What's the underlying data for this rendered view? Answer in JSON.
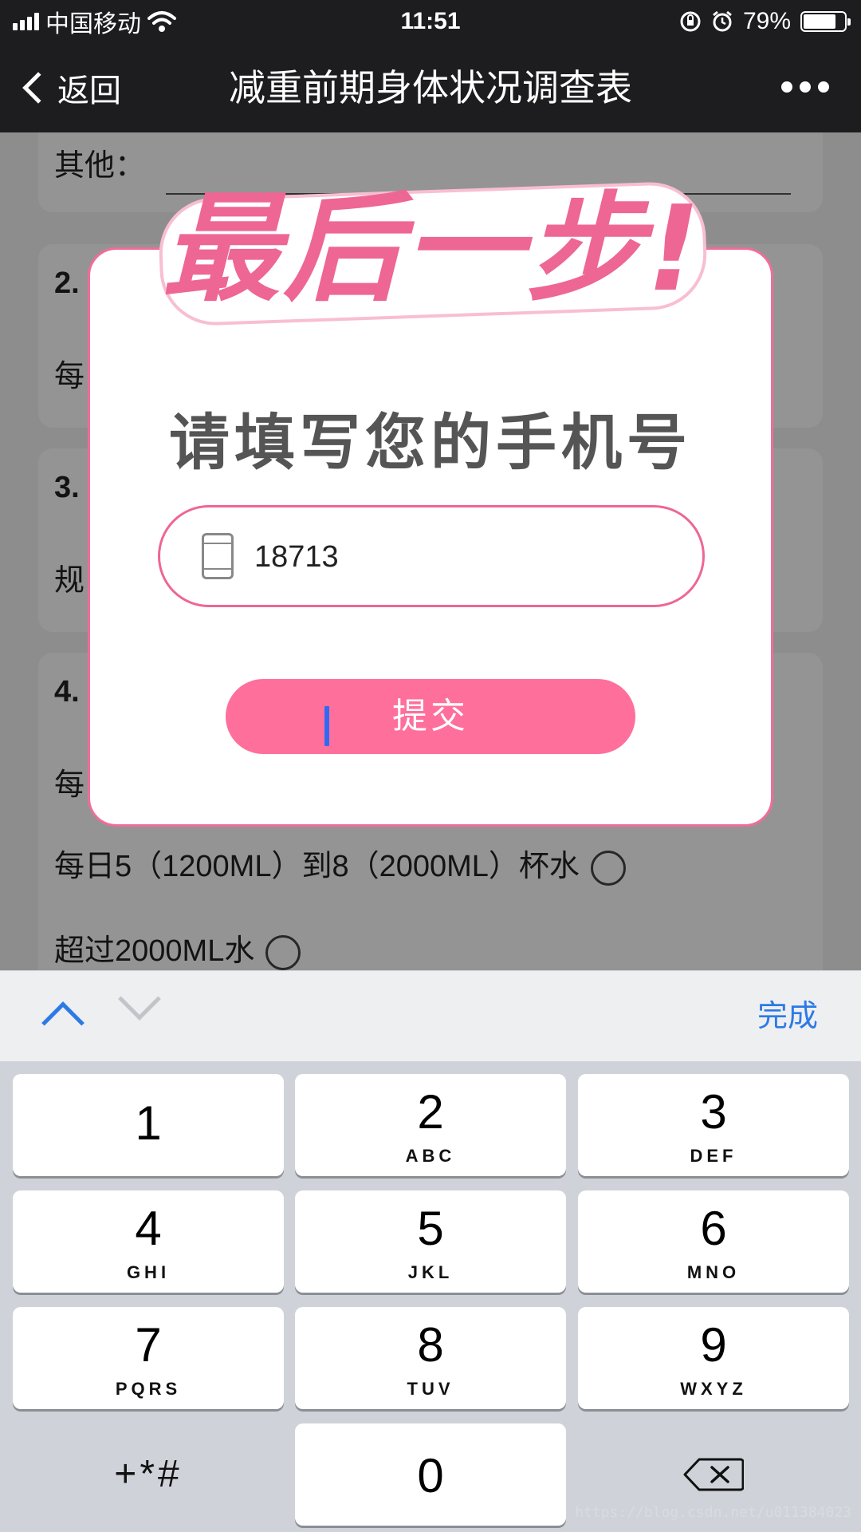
{
  "status_bar": {
    "carrier": "中国移动",
    "time": "11:51",
    "battery": "79%",
    "battery_level": 0.79
  },
  "nav": {
    "back_label": "返回",
    "title": "减重前期身体状况调查表"
  },
  "survey": {
    "other_label": "其他：",
    "q2_num": "2.",
    "q2_prefix": "每",
    "q3_num": "3.",
    "q3_prefix": "规",
    "q4_num": "4.",
    "q4_option_partial": "每",
    "q4_option_b": "每日5（1200ML）到8（2000ML）杯水",
    "q4_option_c": "超过2000ML水"
  },
  "modal": {
    "banner": "最后一步!",
    "prompt": "请填写您的手机号",
    "phone_value": "18713",
    "submit_label": "提交"
  },
  "accessory": {
    "done_label": "完成"
  },
  "keypad": {
    "keys": [
      {
        "num": "1",
        "letters": ""
      },
      {
        "num": "2",
        "letters": "ABC"
      },
      {
        "num": "3",
        "letters": "DEF"
      },
      {
        "num": "4",
        "letters": "GHI"
      },
      {
        "num": "5",
        "letters": "JKL"
      },
      {
        "num": "6",
        "letters": "MNO"
      },
      {
        "num": "7",
        "letters": "PQRS"
      },
      {
        "num": "8",
        "letters": "TUV"
      },
      {
        "num": "9",
        "letters": "WXYZ"
      }
    ],
    "symbols": "+*#",
    "zero": "0"
  },
  "watermark": "https://blog.csdn.net/u011384023",
  "colors": {
    "accent_pink": "#fe6f9c",
    "ios_blue": "#2d7ae6",
    "bar_dark": "#1d1d1f"
  },
  "icons": [
    "signal-icon",
    "wifi-icon",
    "rotation-lock-icon",
    "alarm-icon",
    "battery-icon",
    "back-chevron-icon",
    "more-icon",
    "phone-icon",
    "chevron-up-icon",
    "chevron-down-icon",
    "delete-icon"
  ]
}
